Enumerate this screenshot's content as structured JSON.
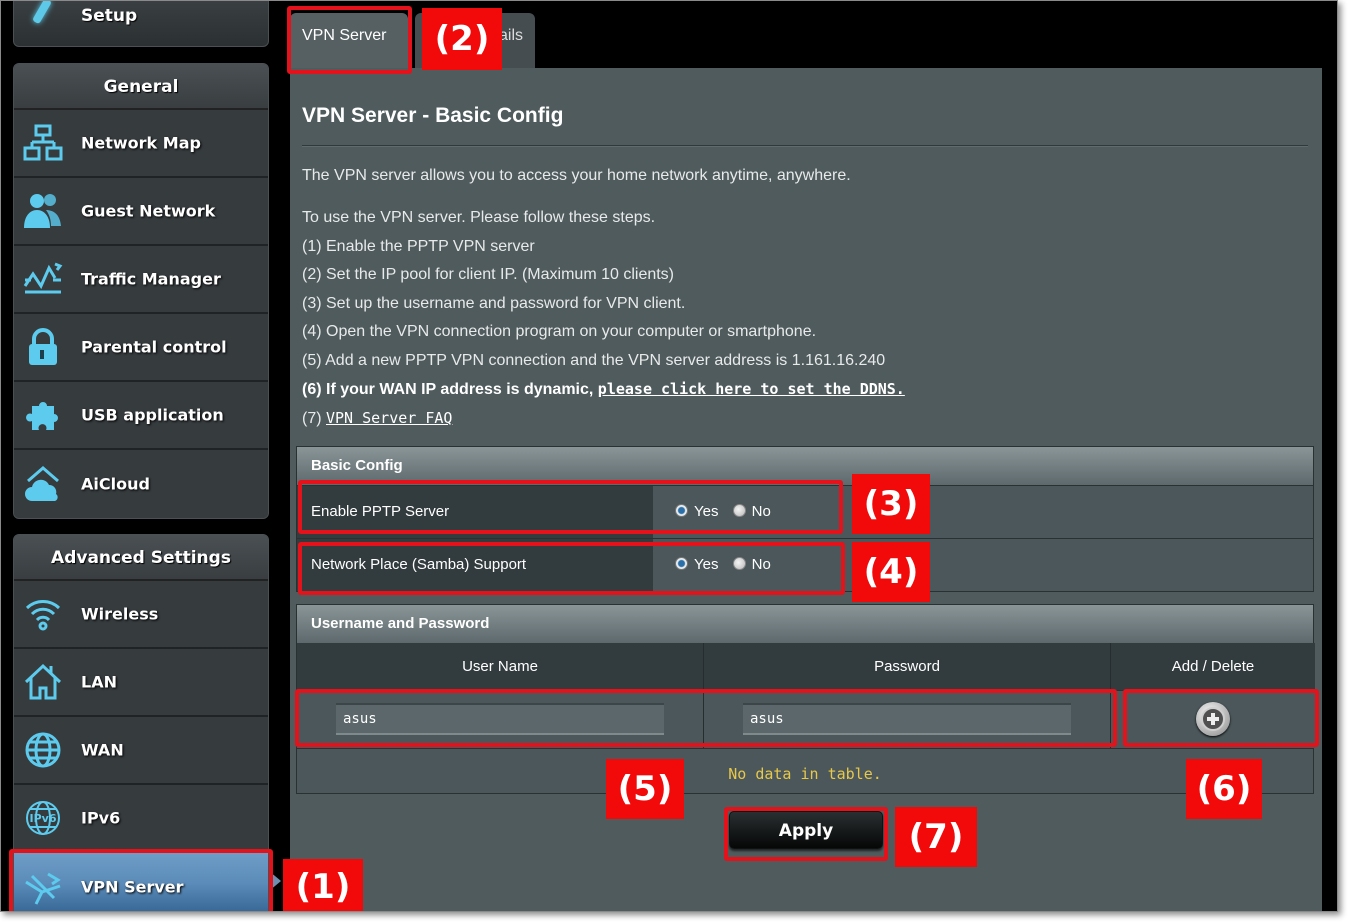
{
  "sidebar": {
    "quick_setup": {
      "label": "Setup",
      "icon": "wand-icon"
    },
    "general": {
      "header": "General",
      "items": [
        {
          "label": "Network Map",
          "icon": "network-map-icon"
        },
        {
          "label": "Guest Network",
          "icon": "guest-network-icon"
        },
        {
          "label": "Traffic Manager",
          "icon": "traffic-manager-icon"
        },
        {
          "label": "Parental control",
          "icon": "lock-icon"
        },
        {
          "label": "USB application",
          "icon": "puzzle-icon"
        },
        {
          "label": "AiCloud",
          "icon": "cloud-home-icon"
        }
      ]
    },
    "advanced": {
      "header": "Advanced Settings",
      "items": [
        {
          "label": "Wireless",
          "icon": "wifi-icon"
        },
        {
          "label": "LAN",
          "icon": "home-icon"
        },
        {
          "label": "WAN",
          "icon": "globe-icon"
        },
        {
          "label": "IPv6",
          "icon": "ipv6-globe-icon"
        },
        {
          "label": "VPN Server",
          "icon": "vpn-icon",
          "active": true
        }
      ]
    }
  },
  "tabs": [
    {
      "label": "VPN Server",
      "active": true
    },
    {
      "label": "ails",
      "active": false
    }
  ],
  "page": {
    "title": "VPN Server - Basic Config",
    "intro": "The VPN server allows you to access your home network anytime, anywhere.",
    "steps_intro": "To use the VPN server. Please follow these steps.",
    "steps": [
      "(1) Enable the PPTP VPN server",
      "(2) Set the IP pool for client IP. (Maximum 10 clients)",
      "(3) Set up the username and password for VPN client.",
      "(4) Open the VPN connection program on your computer or smartphone.",
      "(5) Add a new PPTP VPN connection and the VPN server address is 1.161.16.240"
    ],
    "step6_text": "(6) If your WAN IP address is dynamic, ",
    "step6_link": "please click here to set the DDNS.",
    "step7_prefix": "(7) ",
    "step7_link": "VPN Server FAQ"
  },
  "basic_config": {
    "header": "Basic Config",
    "rows": [
      {
        "label": "Enable PPTP Server",
        "options": [
          "Yes",
          "No"
        ],
        "selected": "Yes"
      },
      {
        "label": "Network Place (Samba) Support",
        "options": [
          "Yes",
          "No"
        ],
        "selected": "Yes"
      }
    ]
  },
  "credentials": {
    "header": "Username and Password",
    "columns": [
      "User Name",
      "Password",
      "Add / Delete"
    ],
    "username_value": "asus",
    "password_value": "asus",
    "empty_message": "No data in table."
  },
  "apply_label": "Apply",
  "annotations": [
    "(1)",
    "(2)",
    "(3)",
    "(4)",
    "(5)",
    "(6)",
    "(7)"
  ],
  "colors": {
    "annotation_red": "#f20a0a",
    "panel_bg": "#4f5b5d",
    "active_nav": "#5b8bb8",
    "no_data_text": "#e8c84a"
  }
}
